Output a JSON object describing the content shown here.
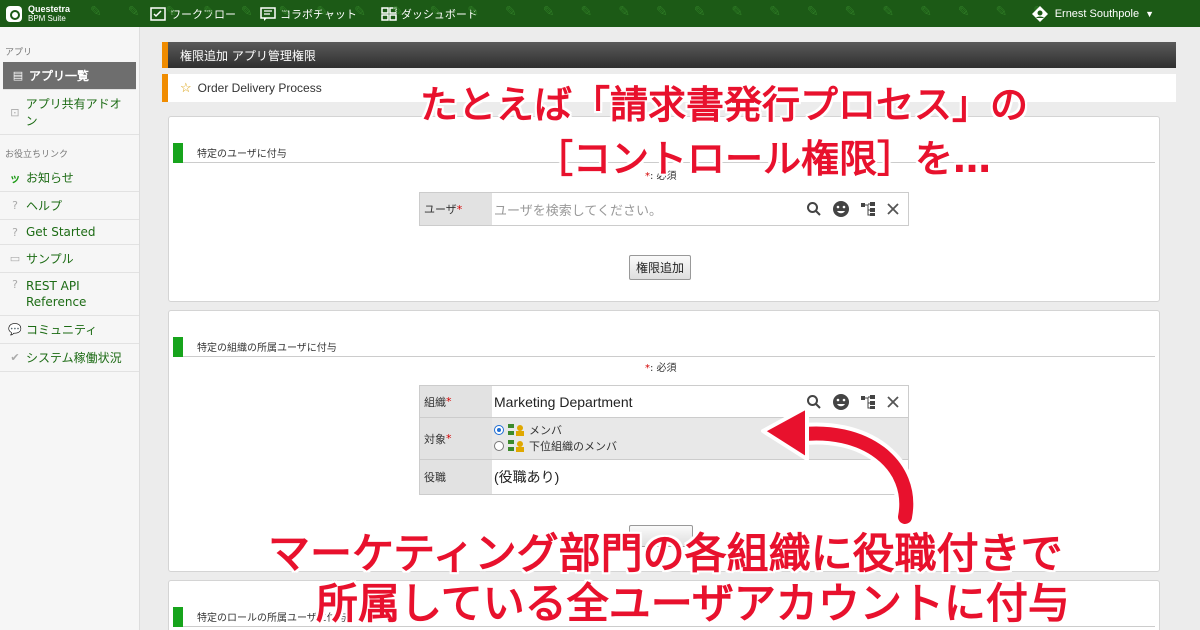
{
  "app": {
    "brand_name": "Questetra",
    "brand_sub": "BPM Suite"
  },
  "topnav": {
    "items": [
      {
        "label": "ワークフロー",
        "icon": "workflow-icon"
      },
      {
        "label": "コラボチャット",
        "icon": "chat-icon"
      },
      {
        "label": "ダッシュボード",
        "icon": "dashboard-icon"
      }
    ],
    "user_name": "Ernest Southpole"
  },
  "sidebar": {
    "section_app": "アプリ",
    "items_app": [
      {
        "label": "アプリ一覧",
        "active": true
      },
      {
        "label": "アプリ共有アドオン",
        "active": false
      }
    ],
    "section_links": "お役立ちリンク",
    "items_links": [
      {
        "label": "お知らせ"
      },
      {
        "label": "ヘルプ"
      },
      {
        "label": "Get Started"
      },
      {
        "label": "サンプル"
      },
      {
        "label": "REST API Reference"
      },
      {
        "label": "コミュニティ"
      },
      {
        "label": "システム稼働状況"
      }
    ]
  },
  "main": {
    "breadcrumb": "権限追加 アプリ管理権限",
    "process_name": "Order Delivery Process",
    "panel_user": {
      "title": "特定のユーザに付与",
      "required_note": ": 必須",
      "required_mark": "*",
      "user_label": "ユーザ",
      "user_placeholder": "ユーザを検索してください。",
      "add_button": "権限追加"
    },
    "panel_org": {
      "title": "特定の組織の所属ユーザに付与",
      "required_note": ": 必須",
      "required_mark": "*",
      "org_label": "組織",
      "org_value": "Marketing Department",
      "target_label": "対象",
      "target_options": [
        {
          "label": "メンバ",
          "selected": true
        },
        {
          "label": "下位組織のメンバ",
          "selected": false
        }
      ],
      "role_label": "役職",
      "role_value": "(役職あり)"
    },
    "panel_role": {
      "title": "特定のロールの所属ユーザに付与"
    }
  },
  "overlay": {
    "caption_line1": "たとえば「請求書発行プロセス」の",
    "caption_line2": "［コントロール権限］を…",
    "caption_line3": "マーケティング部門の各組織に役職付きで",
    "caption_line4": "所属している全ユーザアカウントに付与",
    "caption_color": "#e8112d"
  }
}
